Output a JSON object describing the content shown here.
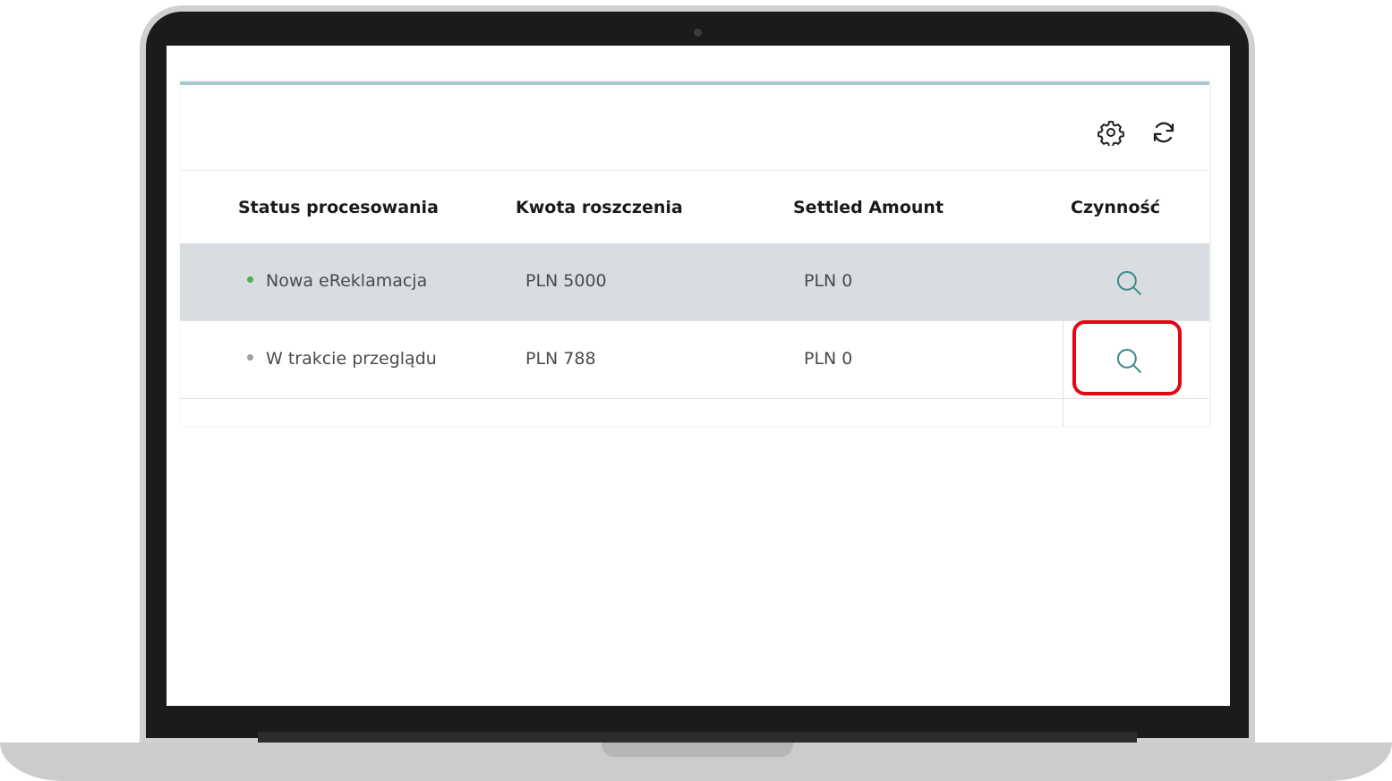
{
  "table": {
    "columns": {
      "status": "Status procesowania",
      "claim_amount": "Kwota roszczenia",
      "settled_amount": "Settled Amount",
      "action": "Czynność"
    },
    "rows": [
      {
        "status": "Nowa eReklamacja",
        "status_color": "#4caf50",
        "claim_amount": "PLN 5000",
        "settled_amount": "PLN 0",
        "selected": true
      },
      {
        "status": "W trakcie przeglądu",
        "status_color": "#9e9e9e",
        "claim_amount": "PLN 788",
        "settled_amount": "PLN 0",
        "selected": false
      }
    ]
  },
  "toolbar": {
    "icons": [
      "gear-icon",
      "refresh-icon"
    ]
  },
  "colors": {
    "accent": "#3d8a88",
    "highlight": "#e30613",
    "selected_row": "#d9dde1",
    "top_rule": "#a9c7cf"
  }
}
